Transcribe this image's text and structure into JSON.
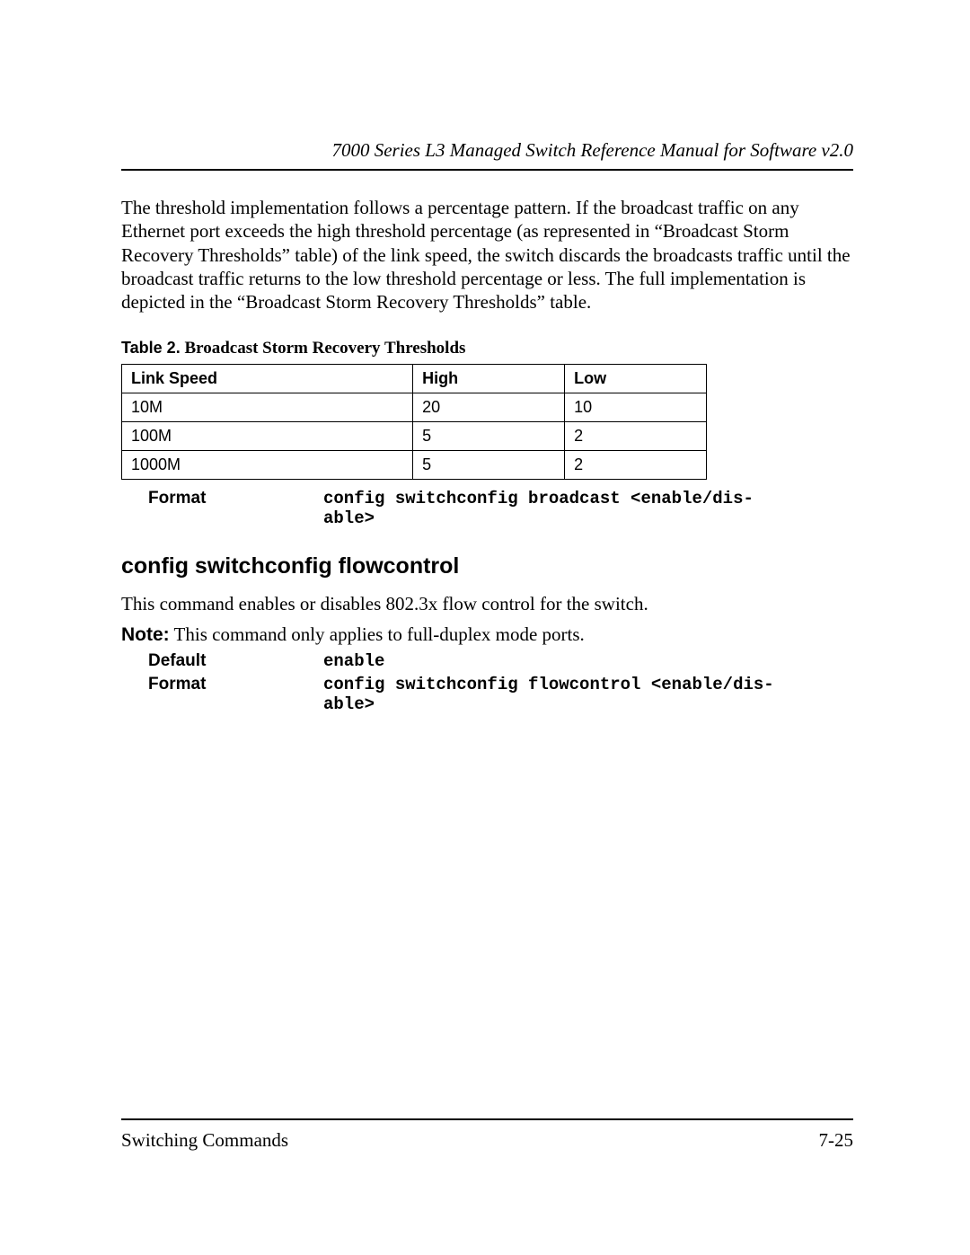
{
  "header": {
    "title": "7000 Series L3 Managed Switch Reference Manual for Software v2.0"
  },
  "intro_paragraph": "The threshold implementation follows a percentage pattern. If the broadcast traffic on any Ethernet port exceeds the high threshold percentage (as represented in “Broadcast Storm Recovery Thresholds” table) of the link speed, the switch discards the broadcasts traffic until the broadcast traffic returns to the low threshold percentage or less. The full implementation is depicted in the “Broadcast Storm Recovery Thresholds” table.",
  "table": {
    "caption_label": "Table 2.",
    "caption_title": "Broadcast Storm Recovery Thresholds",
    "columns": {
      "c0": "Link Speed",
      "c1": "High",
      "c2": "Low"
    },
    "rows": [
      {
        "c0": "10M",
        "c1": "20",
        "c2": "10"
      },
      {
        "c0": "100M",
        "c1": "5",
        "c2": "2"
      },
      {
        "c0": "1000M",
        "c1": "5",
        "c2": "2"
      }
    ]
  },
  "broadcast_format": {
    "label": "Format",
    "value": "config switchconfig broadcast <enable/dis-\nable>"
  },
  "section2": {
    "heading": "config switchconfig flowcontrol",
    "desc": "This command enables or disables 802.3x flow control for the switch.",
    "note_label": "Note:",
    "note_text": " This command only applies to full-duplex mode ports.",
    "default": {
      "label": "Default",
      "value": "enable"
    },
    "format": {
      "label": "Format",
      "value": "config switchconfig flowcontrol <enable/dis-\nable>"
    }
  },
  "footer": {
    "left": "Switching Commands",
    "right": "7-25"
  }
}
